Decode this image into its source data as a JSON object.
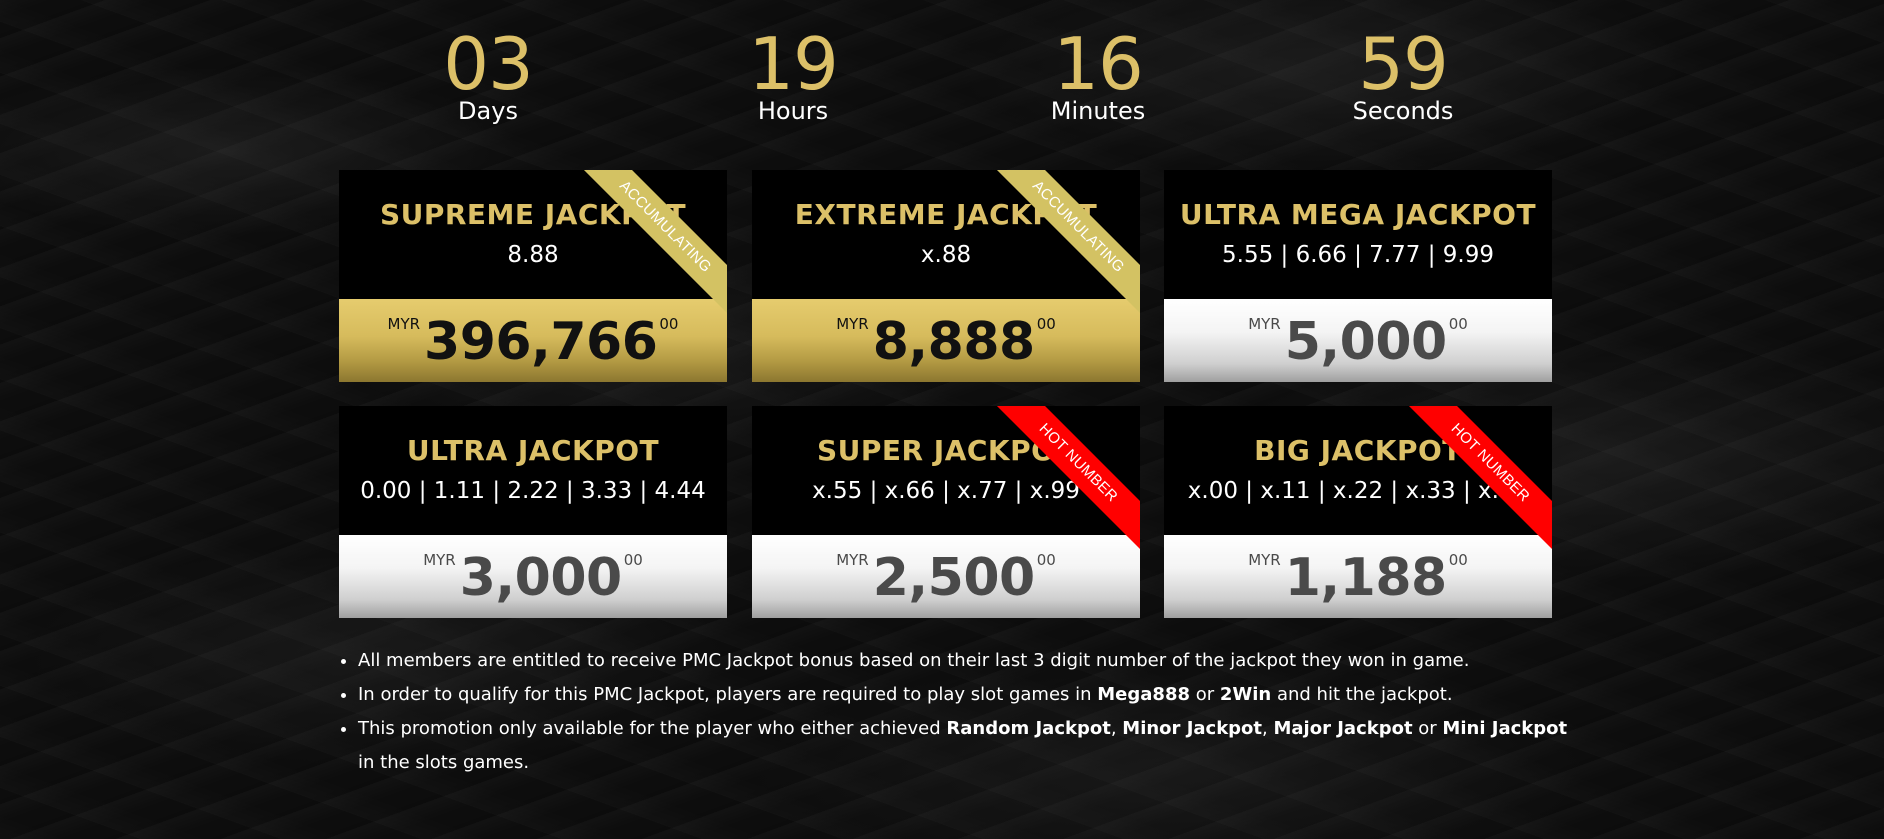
{
  "countdown": {
    "days": {
      "value": "03",
      "label": "Days"
    },
    "hours": {
      "value": "19",
      "label": "Hours"
    },
    "minutes": {
      "value": "16",
      "label": "Minutes"
    },
    "seconds": {
      "value": "59",
      "label": "Seconds"
    }
  },
  "cards": [
    {
      "title": "SUPREME JACKPOT",
      "numbers": "8.88",
      "currency": "MYR",
      "amount": "396,766",
      "decimals": "00",
      "style": "gold",
      "ribbon": "ACCUMULATING"
    },
    {
      "title": "EXTREME JACKPOT",
      "numbers": "x.88",
      "currency": "MYR",
      "amount": "8,888",
      "decimals": "00",
      "style": "gold",
      "ribbon": "ACCUMULATING"
    },
    {
      "title": "ULTRA MEGA JACKPOT",
      "numbers": "5.55 | 6.66 | 7.77 | 9.99",
      "currency": "MYR",
      "amount": "5,000",
      "decimals": "00",
      "style": "silver",
      "ribbon": ""
    },
    {
      "title": "ULTRA JACKPOT",
      "numbers": "0.00 | 1.11 | 2.22 | 3.33 | 4.44",
      "currency": "MYR",
      "amount": "3,000",
      "decimals": "00",
      "style": "silver",
      "ribbon": ""
    },
    {
      "title": "SUPER JACKPOT",
      "numbers": "x.55 | x.66 | x.77 | x.99",
      "currency": "MYR",
      "amount": "2,500",
      "decimals": "00",
      "style": "silver",
      "ribbon": "HOT NUMBER"
    },
    {
      "title": "BIG JACKPOT",
      "numbers": "x.00 | x.11 | x.22 | x.33 | x.44",
      "currency": "MYR",
      "amount": "1,188",
      "decimals": "00",
      "style": "silver",
      "ribbon": "HOT NUMBER"
    }
  ],
  "notes": {
    "n1": "All members are entitled to receive PMC Jackpot bonus based on their last 3 digit number of the jackpot they won in game.",
    "n2_a": "In order to qualify for this PMC Jackpot, players are required to play slot games in ",
    "n2_b": "Mega888",
    "n2_c": " or ",
    "n2_d": "2Win",
    "n2_e": " and hit the jackpot.",
    "n3_a": "This promotion only available for the player who either achieved ",
    "n3_b": "Random Jackpot",
    "n3_c": ", ",
    "n3_d": "Minor Jackpot",
    "n3_e": ", ",
    "n3_f": "Major Jackpot",
    "n3_g": " or ",
    "n3_h": "Mini Jackpot",
    "n3_i": " in the slots games."
  },
  "colors": {
    "gold": "#dcc068",
    "accumulating_ribbon": "#d3c263",
    "hot_ribbon": "#ff0000",
    "card_bg": "#000000"
  }
}
